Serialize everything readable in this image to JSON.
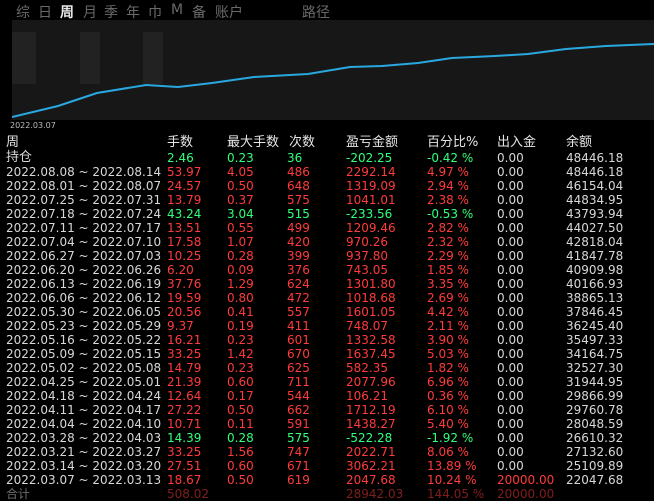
{
  "tabs": [
    "综",
    "日",
    "周",
    "月",
    "季",
    "年",
    "巾",
    "M",
    "备",
    "账户",
    "路径"
  ],
  "active_tab": "周",
  "chart": {
    "start_date": "2022.03.07"
  },
  "columns": [
    "周",
    "手数",
    "最大手数",
    "次数",
    "盈亏金额",
    "百分比%",
    "出入金",
    "余额"
  ],
  "holding": {
    "label": "持仓",
    "lots": "2.46",
    "max_lots": "0.23",
    "count": "36",
    "pnl": "-202.25",
    "pct": "-0.42 %",
    "flow": "0.00",
    "balance": "48446.18"
  },
  "rows": [
    {
      "week": "2022.08.08 ~ 2022.08.14",
      "lots": "53.97",
      "max_lots": "4.05",
      "count": "486",
      "pnl": "2292.14",
      "pct": "4.97 %",
      "flow": "0.00",
      "balance": "48446.18",
      "sign": "pos"
    },
    {
      "week": "2022.08.01 ~ 2022.08.07",
      "lots": "24.57",
      "max_lots": "0.50",
      "count": "648",
      "pnl": "1319.09",
      "pct": "2.94 %",
      "flow": "0.00",
      "balance": "46154.04",
      "sign": "pos"
    },
    {
      "week": "2022.07.25 ~ 2022.07.31",
      "lots": "13.79",
      "max_lots": "0.37",
      "count": "575",
      "pnl": "1041.01",
      "pct": "2.38 %",
      "flow": "0.00",
      "balance": "44834.95",
      "sign": "pos"
    },
    {
      "week": "2022.07.18 ~ 2022.07.24",
      "lots": "43.24",
      "max_lots": "3.04",
      "count": "515",
      "pnl": "-233.56",
      "pct": "-0.53 %",
      "flow": "0.00",
      "balance": "43793.94",
      "sign": "neg"
    },
    {
      "week": "2022.07.11 ~ 2022.07.17",
      "lots": "13.51",
      "max_lots": "0.55",
      "count": "499",
      "pnl": "1209.46",
      "pct": "2.82 %",
      "flow": "0.00",
      "balance": "44027.50",
      "sign": "pos"
    },
    {
      "week": "2022.07.04 ~ 2022.07.10",
      "lots": "17.58",
      "max_lots": "1.07",
      "count": "420",
      "pnl": "970.26",
      "pct": "2.32 %",
      "flow": "0.00",
      "balance": "42818.04",
      "sign": "pos"
    },
    {
      "week": "2022.06.27 ~ 2022.07.03",
      "lots": "10.25",
      "max_lots": "0.28",
      "count": "399",
      "pnl": "937.80",
      "pct": "2.29 %",
      "flow": "0.00",
      "balance": "41847.78",
      "sign": "pos"
    },
    {
      "week": "2022.06.20 ~ 2022.06.26",
      "lots": "6.20",
      "max_lots": "0.09",
      "count": "376",
      "pnl": "743.05",
      "pct": "1.85 %",
      "flow": "0.00",
      "balance": "40909.98",
      "sign": "pos"
    },
    {
      "week": "2022.06.13 ~ 2022.06.19",
      "lots": "37.76",
      "max_lots": "1.29",
      "count": "624",
      "pnl": "1301.80",
      "pct": "3.35 %",
      "flow": "0.00",
      "balance": "40166.93",
      "sign": "pos"
    },
    {
      "week": "2022.06.06 ~ 2022.06.12",
      "lots": "19.59",
      "max_lots": "0.80",
      "count": "472",
      "pnl": "1018.68",
      "pct": "2.69 %",
      "flow": "0.00",
      "balance": "38865.13",
      "sign": "pos"
    },
    {
      "week": "2022.05.30 ~ 2022.06.05",
      "lots": "20.56",
      "max_lots": "0.41",
      "count": "557",
      "pnl": "1601.05",
      "pct": "4.42 %",
      "flow": "0.00",
      "balance": "37846.45",
      "sign": "pos"
    },
    {
      "week": "2022.05.23 ~ 2022.05.29",
      "lots": "9.37",
      "max_lots": "0.19",
      "count": "411",
      "pnl": "748.07",
      "pct": "2.11 %",
      "flow": "0.00",
      "balance": "36245.40",
      "sign": "pos"
    },
    {
      "week": "2022.05.16 ~ 2022.05.22",
      "lots": "16.21",
      "max_lots": "0.23",
      "count": "601",
      "pnl": "1332.58",
      "pct": "3.90 %",
      "flow": "0.00",
      "balance": "35497.33",
      "sign": "pos"
    },
    {
      "week": "2022.05.09 ~ 2022.05.15",
      "lots": "33.25",
      "max_lots": "1.42",
      "count": "670",
      "pnl": "1637.45",
      "pct": "5.03 %",
      "flow": "0.00",
      "balance": "34164.75",
      "sign": "pos"
    },
    {
      "week": "2022.05.02 ~ 2022.05.08",
      "lots": "14.79",
      "max_lots": "0.23",
      "count": "625",
      "pnl": "582.35",
      "pct": "1.82 %",
      "flow": "0.00",
      "balance": "32527.30",
      "sign": "pos"
    },
    {
      "week": "2022.04.25 ~ 2022.05.01",
      "lots": "21.39",
      "max_lots": "0.60",
      "count": "711",
      "pnl": "2077.96",
      "pct": "6.96 %",
      "flow": "0.00",
      "balance": "31944.95",
      "sign": "pos"
    },
    {
      "week": "2022.04.18 ~ 2022.04.24",
      "lots": "12.64",
      "max_lots": "0.17",
      "count": "544",
      "pnl": "106.21",
      "pct": "0.36 %",
      "flow": "0.00",
      "balance": "29866.99",
      "sign": "pos"
    },
    {
      "week": "2022.04.11 ~ 2022.04.17",
      "lots": "27.22",
      "max_lots": "0.50",
      "count": "662",
      "pnl": "1712.19",
      "pct": "6.10 %",
      "flow": "0.00",
      "balance": "29760.78",
      "sign": "pos"
    },
    {
      "week": "2022.04.04 ~ 2022.04.10",
      "lots": "10.71",
      "max_lots": "0.11",
      "count": "591",
      "pnl": "1438.27",
      "pct": "5.40 %",
      "flow": "0.00",
      "balance": "28048.59",
      "sign": "pos"
    },
    {
      "week": "2022.03.28 ~ 2022.04.03",
      "lots": "14.39",
      "max_lots": "0.28",
      "count": "575",
      "pnl": "-522.28",
      "pct": "-1.92 %",
      "flow": "0.00",
      "balance": "26610.32",
      "sign": "neg"
    },
    {
      "week": "2022.03.21 ~ 2022.03.27",
      "lots": "33.25",
      "max_lots": "1.56",
      "count": "747",
      "pnl": "2022.71",
      "pct": "8.06 %",
      "flow": "0.00",
      "balance": "27132.60",
      "sign": "pos"
    },
    {
      "week": "2022.03.14 ~ 2022.03.20",
      "lots": "27.51",
      "max_lots": "0.60",
      "count": "671",
      "pnl": "3062.21",
      "pct": "13.89 %",
      "flow": "0.00",
      "balance": "25109.89",
      "sign": "pos"
    },
    {
      "week": "2022.03.07 ~ 2022.03.13",
      "lots": "18.67",
      "max_lots": "0.50",
      "count": "619",
      "pnl": "2047.68",
      "pct": "10.24 %",
      "flow": "20000.00",
      "balance": "22047.68",
      "sign": "pos"
    }
  ],
  "summary": {
    "label": "合计",
    "lots": "508.02",
    "max_lots": "",
    "count": "",
    "pnl": "28942.03",
    "pct": "144.05 %",
    "flow": "20000.00",
    "balance": ""
  },
  "colors": {
    "profit": "#ff3b3b",
    "loss": "#32ff7a",
    "curve": "#29a8e0",
    "background": "#000000"
  }
}
